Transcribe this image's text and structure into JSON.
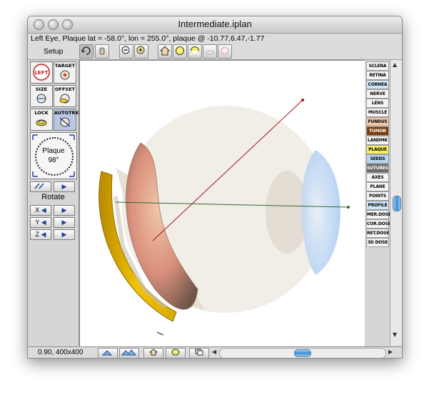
{
  "window": {
    "title": "Intermediate.iplan",
    "status_line": "Left Eye, Plaque lat = -58.0°, lon = 255.0°, plaque @ -10.77,6.47,-1.77"
  },
  "toolbar": {
    "setup_label": "Setup",
    "buttons": [
      "rotate-view-icon",
      "hand-icon",
      "zoom-out-icon",
      "zoom-in-icon",
      "home-icon",
      "lens-view-icon",
      "lens-cut-icon",
      "flat-view-icon",
      "disabled-view-icon"
    ]
  },
  "left_panel": {
    "left_label": "LEFT",
    "target_label": "TARGET",
    "size_label": "SIZE",
    "offset_label": "OFFSET",
    "lock_label": "LOCK",
    "autotrk_label": "AUTOTRK",
    "dial_label": "Plaque",
    "dial_value": "98°",
    "rotate_label": "Rotate",
    "axis_x": "X",
    "axis_y": "Y",
    "axis_z": "Z",
    "left_arrow": "◀",
    "right_arrow": "▶"
  },
  "right_panel": {
    "items": [
      {
        "label": "SCLERA",
        "color": "#f4f4f4"
      },
      {
        "label": "RETINA",
        "color": "#f4f4f4"
      },
      {
        "label": "CORNEA",
        "color": "#cfe6fb"
      },
      {
        "label": "NERVE",
        "color": "#f4f4f4"
      },
      {
        "label": "LENS",
        "color": "#f4f4f4"
      },
      {
        "label": "MUSCLE",
        "color": "#f4f4f4"
      },
      {
        "label": "FUNDUS",
        "color": "#f2c7a8"
      },
      {
        "label": "TUMOR",
        "color": "#7a3d10"
      },
      {
        "label": "LANDMK",
        "color": "#f4f4f4"
      },
      {
        "label": "PLAQUE",
        "color": "#f8f060"
      },
      {
        "label": "SEEDS",
        "color": "#b8d8f2"
      },
      {
        "label": "SUTURES",
        "color": "#6b6b6b"
      },
      {
        "label": "AXES",
        "color": "#f4f4f4"
      },
      {
        "label": "PLANE",
        "color": "#f4f4f4"
      },
      {
        "label": "POINTS",
        "color": "#f4f4f4"
      },
      {
        "label": "PROFILE",
        "color": "#cfe6fb"
      },
      {
        "label": "MER.DOSE",
        "color": "#f4f4f4"
      },
      {
        "label": "COR.DOSE",
        "color": "#f4f4f4"
      },
      {
        "label": "RET.DOSE",
        "color": "#f4f4f4"
      },
      {
        "label": "3D DOSE",
        "color": "#f4f4f4"
      }
    ]
  },
  "bottom_bar": {
    "zoom_text": "0.90, 400x400"
  }
}
